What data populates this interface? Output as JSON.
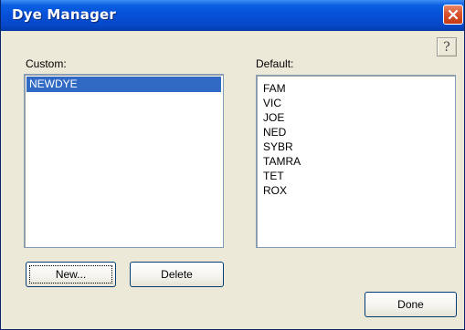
{
  "window": {
    "title": "Dye Manager"
  },
  "help_button": {
    "label": "?"
  },
  "custom": {
    "label": "Custom:",
    "items": [
      "NEWDYE"
    ],
    "selected": "NEWDYE"
  },
  "default": {
    "label": "Default:",
    "items": [
      "FAM",
      "VIC",
      "JOE",
      "NED",
      "SYBR",
      "TAMRA",
      "TET",
      "ROX"
    ]
  },
  "buttons": {
    "new_label": "New...",
    "delete_label": "Delete",
    "done_label": "Done"
  },
  "icons": {
    "close": "close-icon",
    "help": "help-icon"
  },
  "colors": {
    "titlebar": "#0650d8",
    "selection": "#316ac5",
    "close": "#d9532e",
    "dialog_bg": "#ece9d8"
  }
}
